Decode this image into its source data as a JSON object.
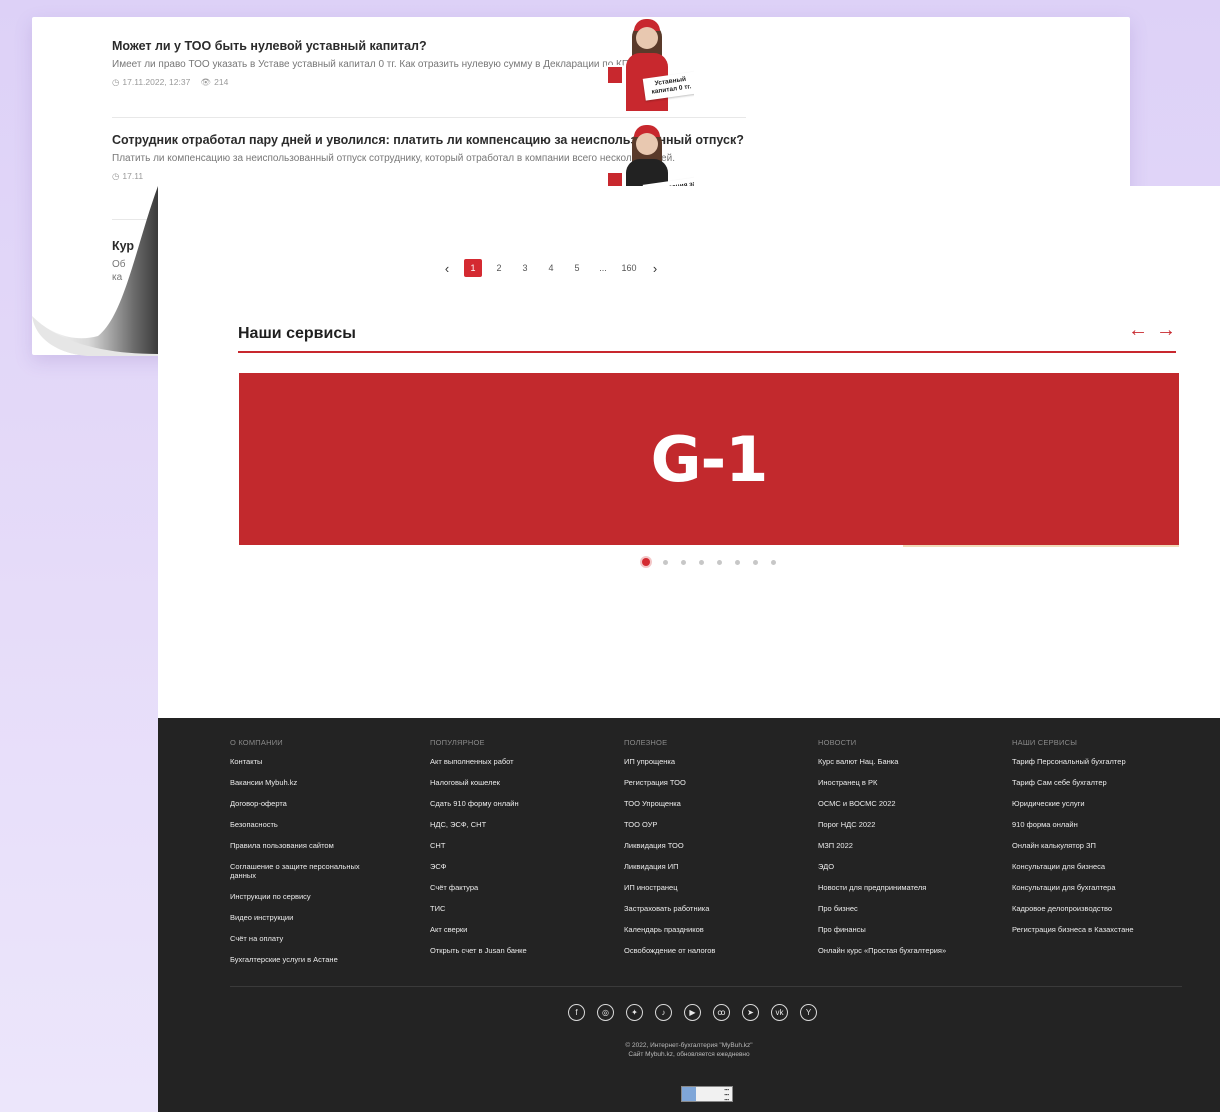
{
  "articles": [
    {
      "title": "Может ли у ТОО быть нулевой уставный капитал?",
      "description": "Имеет ли право ТОО указать в Уставе уставный капитал 0 тг. Как отразить нулевую сумму в Декларации по КПН.",
      "date": "17.11.2022, 12:37",
      "views": "214",
      "thumb_caption": "Уставный капитал 0 тг."
    },
    {
      "title": "Сотрудник отработал пару дней и уволился: платить ли компенсацию за неиспользованный отпуск?",
      "description": "Платить ли компенсацию за неиспользованный отпуск сотруднику, который отработал в компании всего несколько дней.",
      "date": "17.11",
      "views": "",
      "thumb_caption": "Компенсация за неиспользованный"
    },
    {
      "title": "Кур",
      "description": "Об ка",
      "date": "",
      "views": "",
      "thumb_caption": ""
    }
  ],
  "pagination": {
    "prev": "‹",
    "pages": [
      "1",
      "2",
      "3",
      "4",
      "5",
      "...",
      "160"
    ],
    "next": "›",
    "current": "1"
  },
  "services": {
    "title": "Наши сервисы",
    "arrow_prev": "←",
    "arrow_next": "→",
    "banner_text": "G-1",
    "slide_count": 8,
    "active_slide": 1
  },
  "footer": {
    "columns": [
      {
        "heading": "О КОМПАНИИ",
        "links": [
          "Контакты",
          "Вакансии Mybuh.kz",
          "Договор-оферта",
          "Безопасность",
          "Правила пользования сайтом",
          "Соглашение о защите персональных данных",
          "Инструкции по сервису",
          "Видео инструкции",
          "Счёт на оплату",
          "Бухгалтерские услуги в Астане"
        ]
      },
      {
        "heading": "ПОПУЛЯРНОЕ",
        "links": [
          "Акт выполненных работ",
          "Налоговый кошелек",
          "Сдать 910 форму онлайн",
          "НДС, ЭСФ, СНТ",
          "СНТ",
          "ЭСФ",
          "Счёт фактура",
          "ТИС",
          "Акт сверки",
          "Открыть счет в Jusan банке"
        ]
      },
      {
        "heading": "ПОЛЕЗНОЕ",
        "links": [
          "ИП упрощенка",
          "Регистрация ТОО",
          "ТОО Упрощенка",
          "ТОО ОУР",
          "Ликвидация ТОО",
          "Ликвидация ИП",
          "ИП иностранец",
          "Застраховать работника",
          "Календарь праздников",
          "Освобождение от налогов"
        ]
      },
      {
        "heading": "НОВОСТИ",
        "links": [
          "Курс валют Нац. Банка",
          "Иностранец в РК",
          "ОСМС и ВОСМС 2022",
          "Порог НДС 2022",
          "МЗП 2022",
          "ЭДО",
          "Новости для предпринимателя",
          "Про бизнес",
          "Про финансы",
          "Онлайн курс «Простая бухгалтерия»"
        ]
      },
      {
        "heading": "НАШИ СЕРВИСЫ",
        "links": [
          "Тариф Персональный бухгалтер",
          "Тариф Сам себе бухгалтер",
          "Юридические услуги",
          "910 форма онлайн",
          "Онлайн калькулятор ЗП",
          "Консультации для бизнеса",
          "Консультации для бухгалтера",
          "Кадровое делопроизводство",
          "Регистрация бизнеса в Казахстане"
        ]
      }
    ],
    "socials": [
      {
        "icon": "facebook-icon",
        "glyph": "f"
      },
      {
        "icon": "instagram-icon",
        "glyph": "◎"
      },
      {
        "icon": "twitter-icon",
        "glyph": "✦"
      },
      {
        "icon": "tiktok-icon",
        "glyph": "♪"
      },
      {
        "icon": "youtube-icon",
        "glyph": "▶"
      },
      {
        "icon": "odnoklassniki-icon",
        "glyph": "ꝏ"
      },
      {
        "icon": "telegram-icon",
        "glyph": "➤"
      },
      {
        "icon": "vk-icon",
        "glyph": "vk"
      },
      {
        "icon": "yandex-icon",
        "glyph": "Y"
      }
    ],
    "copyright_line1": "© 2022, Интернет-бухгалтерия \"MyBuh.kz\"",
    "copyright_line2": "Сайт Mybuh.kz, обновляется ежедневно"
  },
  "colors": {
    "accent": "#c8282e",
    "banner": "#c2292d",
    "footer_bg": "#232323",
    "page_bg": "#ddd1f7"
  }
}
